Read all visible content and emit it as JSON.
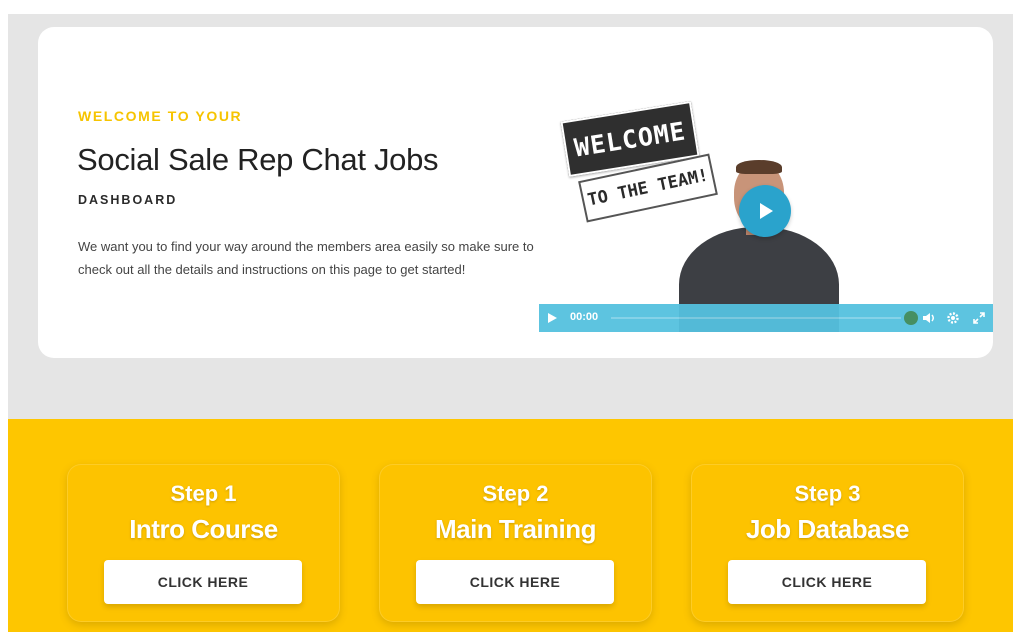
{
  "hero": {
    "eyebrow": "WELCOME TO YOUR",
    "title": "Social Sale Rep Chat Jobs",
    "subtitle": "DASHBOARD",
    "intro": "We want you to find your way around the members area easily so make sure to check out all the details and instructions on this page to get started!"
  },
  "video": {
    "sign_welcome": "WELCOME",
    "sign_team": "TO THE TEAM!",
    "time": "00:00",
    "controls": [
      "play-icon",
      "volume-icon",
      "gear-icon",
      "fullscreen-icon"
    ],
    "bar_color": "#55c1df",
    "play_color": "#2aa3cc"
  },
  "steps": [
    {
      "step": "Step 1",
      "title": "Intro Course",
      "button": "CLICK HERE"
    },
    {
      "step": "Step 2",
      "title": "Main Training",
      "button": "CLICK HERE"
    },
    {
      "step": "Step 3",
      "title": "Job Database",
      "button": "CLICK HERE"
    }
  ],
  "colors": {
    "accent_yellow": "#fec600",
    "eyebrow_yellow": "#f6c400",
    "background_gray": "#e5e5e5"
  }
}
